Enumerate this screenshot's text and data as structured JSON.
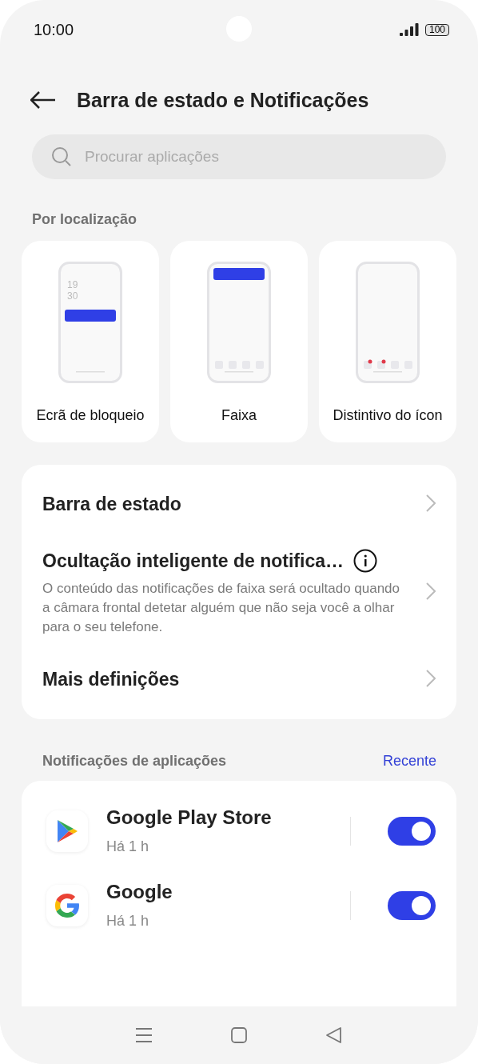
{
  "status_bar": {
    "time": "10:00",
    "battery": "100"
  },
  "header": {
    "title": "Barra de estado e Notificações"
  },
  "search": {
    "placeholder": "Procurar aplicações"
  },
  "location": {
    "label": "Por localização",
    "tiles": [
      {
        "kind": "lockscreen",
        "label": "Ecrã de bloqueio",
        "clock": [
          "19",
          "30"
        ]
      },
      {
        "kind": "banner",
        "label": "Faixa"
      },
      {
        "kind": "badge",
        "label": "Distintivo do ícon"
      }
    ]
  },
  "settings": [
    {
      "kind": "plain",
      "title": "Barra de estado"
    },
    {
      "kind": "info",
      "title": "Ocultação inteligente de notifica…",
      "description": "O conteúdo das notificações de faixa será ocultado quando a câmara frontal detetar alguém que não seja você a olhar para o seu telefone."
    },
    {
      "kind": "plain",
      "title": "Mais definições"
    }
  ],
  "app_notifications": {
    "label": "Notificações de aplicações",
    "sort": "Recente",
    "apps": [
      {
        "kind": "play",
        "name": "Google Play Store",
        "time": "Há 1 h",
        "on": true
      },
      {
        "kind": "google",
        "name": "Google",
        "time": "Há 1 h",
        "on": true
      }
    ]
  }
}
